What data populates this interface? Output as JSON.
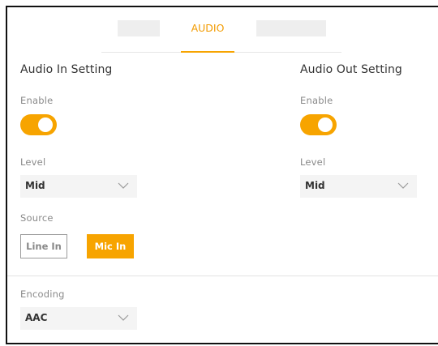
{
  "tabs": {
    "active_label": "AUDIO"
  },
  "audio_in": {
    "title": "Audio In Setting",
    "enable_label": "Enable",
    "enabled": true,
    "level_label": "Level",
    "level_value": "Mid",
    "source_label": "Source",
    "source_options": [
      "Line In",
      "Mic In"
    ],
    "source_selected": "Mic In",
    "encoding_label": "Encoding",
    "encoding_value": "AAC"
  },
  "audio_out": {
    "title": "Audio Out Setting",
    "enable_label": "Enable",
    "enabled": true,
    "level_label": "Level",
    "level_value": "Mid"
  },
  "colors": {
    "accent": "#f7a400",
    "control_bg": "#f4f4f4"
  }
}
